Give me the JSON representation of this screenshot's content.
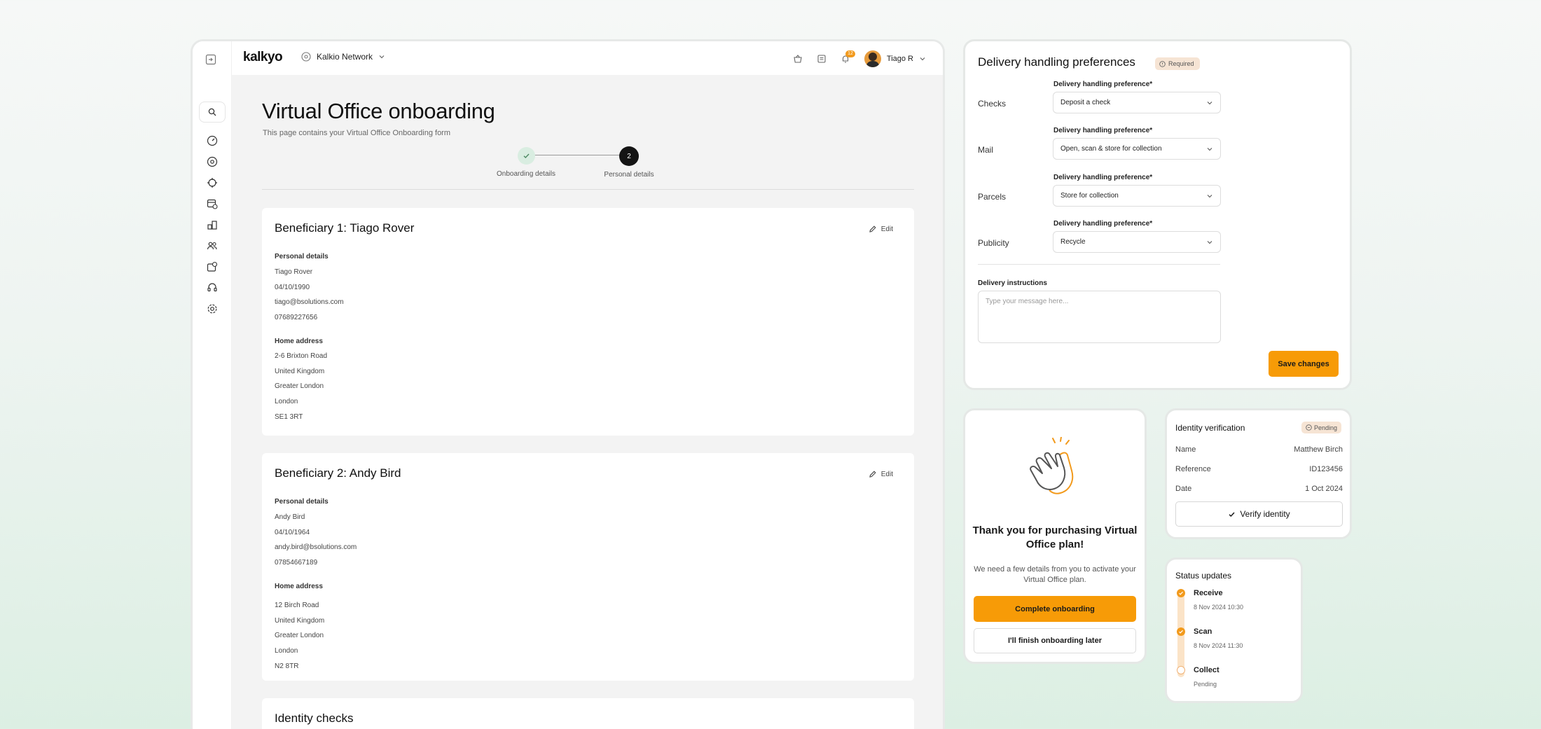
{
  "app": {
    "logo": "kalkyo",
    "network": "Kalkio Network",
    "notification_count": "12",
    "user_name": "Tiago R"
  },
  "page": {
    "title": "Virtual Office onboarding",
    "subtitle": "This page contains your Virtual Office Onboarding form",
    "steps": [
      {
        "label": "Onboarding details",
        "status": "complete"
      },
      {
        "label": "Personal details",
        "number": "2",
        "status": "current"
      }
    ]
  },
  "beneficiaries": [
    {
      "title": "Beneficiary 1: Tiago Rover",
      "edit_label": "Edit",
      "personal_heading": "Personal details",
      "personal": [
        "Tiago Rover",
        "04/10/1990",
        "tiago@bsolutions.com",
        "07689227656"
      ],
      "address_heading": "Home address",
      "address": [
        "2-6 Brixton Road",
        "United Kingdom",
        "Greater London",
        "London",
        "SE1 3RT"
      ]
    },
    {
      "title": "Beneficiary 2: Andy Bird",
      "edit_label": "Edit",
      "personal_heading": "Personal details",
      "personal": [
        "Andy Bird",
        "04/10/1964",
        "andy.bird@bsolutions.com",
        "07854667189"
      ],
      "address_heading": "Home address",
      "address": [
        "12 Birch Road",
        "United Kingdom",
        "Greater London",
        "London",
        "N2 8TR"
      ]
    }
  ],
  "identity_checks_title": "Identity checks",
  "delivery": {
    "title": "Delivery handling preferences",
    "required_badge": "Required",
    "rows": [
      {
        "label": "Checks",
        "field_label": "Delivery handling preference*",
        "value": "Deposit a check"
      },
      {
        "label": "Mail",
        "field_label": "Delivery handling preference*",
        "value": "Open, scan & store for collection"
      },
      {
        "label": "Parcels",
        "field_label": "Delivery handling preference*",
        "value": "Store for collection"
      },
      {
        "label": "Publicity",
        "field_label": "Delivery handling preference*",
        "value": "Recycle"
      }
    ],
    "instructions_label": "Delivery instructions",
    "instructions_placeholder": "Type your message here...",
    "save_label": "Save changes"
  },
  "thanks": {
    "title": "Thank you for purchasing Virtual Office plan!",
    "body": "We need a few details from you to activate your Virtual Office plan.",
    "primary_label": "Complete onboarding",
    "secondary_label": "I'll finish onboarding later"
  },
  "identity": {
    "title": "Identity verification",
    "badge": "Pending",
    "fields": [
      {
        "key": "Name",
        "value": "Matthew Birch"
      },
      {
        "key": "Reference",
        "value": "ID123456"
      },
      {
        "key": "Date",
        "value": "1 Oct 2024"
      }
    ],
    "verify_label": "Verify identity"
  },
  "status": {
    "title": "Status updates",
    "items": [
      {
        "title": "Receive",
        "sub": "8 Nov 2024 10:30",
        "state": "done"
      },
      {
        "title": "Scan",
        "sub": "8 Nov 2024 11:30",
        "state": "done"
      },
      {
        "title": "Collect",
        "sub": "Pending",
        "state": "pending"
      }
    ]
  },
  "colors": {
    "accent": "#f79b07",
    "badge_bg": "#f6e4d4",
    "step_done_bg": "#d9ede1"
  }
}
